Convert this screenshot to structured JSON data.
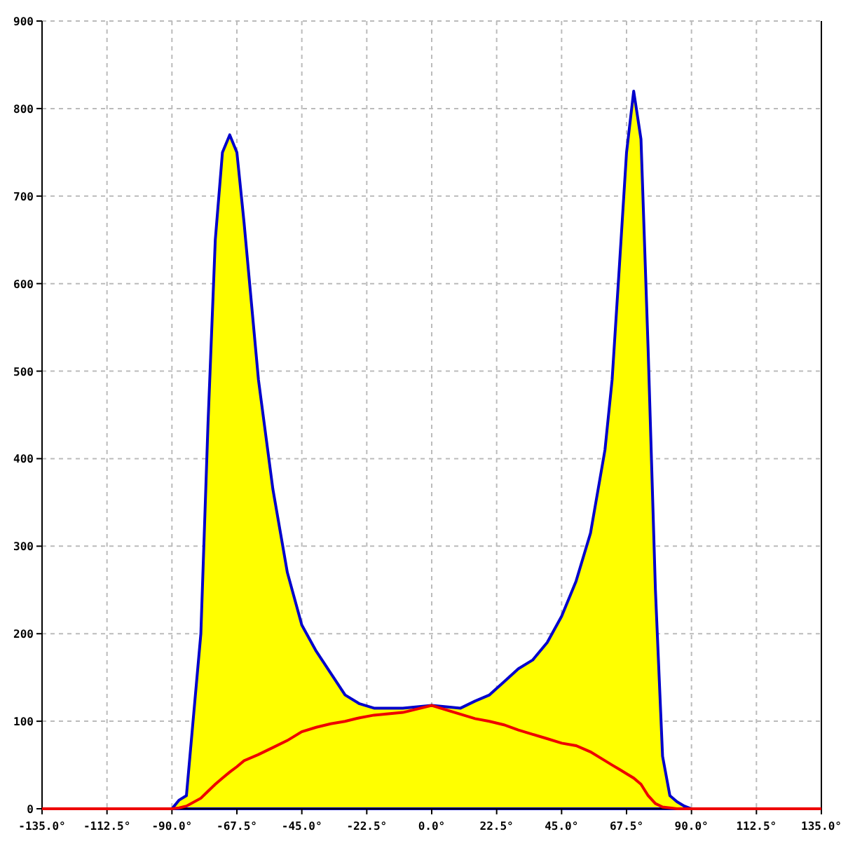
{
  "chart_data": {
    "type": "area",
    "x": [
      -135,
      -112.5,
      -90,
      -87.5,
      -85,
      -80,
      -77.5,
      -75,
      -72.5,
      -70,
      -67.5,
      -65,
      -60,
      -55,
      -50,
      -45,
      -40,
      -35,
      -30,
      -25,
      -20,
      -10,
      0,
      10,
      15,
      20,
      25,
      30,
      35,
      40,
      45,
      50,
      55,
      60,
      62.5,
      65,
      67.5,
      70,
      72.5,
      75,
      77.5,
      80,
      82.5,
      85,
      87.5,
      90,
      112.5,
      135
    ],
    "series": [
      {
        "type": "area",
        "color": "#ffff00",
        "values": [
          null,
          null,
          0,
          10,
          15,
          200,
          440,
          650,
          750,
          770,
          750,
          670,
          490,
          365,
          270,
          210,
          180,
          155,
          130,
          120,
          115,
          115,
          118,
          115,
          123,
          130,
          145,
          160,
          170,
          190,
          220,
          260,
          315,
          410,
          490,
          620,
          750,
          820,
          765,
          525,
          250,
          60,
          15,
          8,
          3,
          0,
          null,
          null
        ]
      },
      {
        "type": "line",
        "color": "#ee0000",
        "values": [
          0,
          0,
          0,
          1,
          3,
          12,
          20,
          28,
          35,
          42,
          48,
          55,
          62,
          70,
          78,
          88,
          93,
          97,
          100,
          104,
          107,
          110,
          118,
          108,
          103,
          100,
          96,
          90,
          85,
          80,
          75,
          72,
          65,
          55,
          50,
          45,
          40,
          35,
          28,
          15,
          6,
          2,
          1,
          0,
          0,
          0,
          0,
          0
        ]
      }
    ],
    "xlim": [
      -135,
      135
    ],
    "ylim": [
      0,
      900
    ],
    "grid": true,
    "xticks": [
      {
        "value": -135,
        "label": "-135.0°"
      },
      {
        "value": -112.5,
        "label": "-112.5°"
      },
      {
        "value": -90,
        "label": "-90.0°"
      },
      {
        "value": -67.5,
        "label": "-67.5°"
      },
      {
        "value": -45,
        "label": "-45.0°"
      },
      {
        "value": -22.5,
        "label": "-22.5°"
      },
      {
        "value": 0,
        "label": "0.0°"
      },
      {
        "value": 22.5,
        "label": "22.5°"
      },
      {
        "value": 45,
        "label": "45.0°"
      },
      {
        "value": 67.5,
        "label": "67.5°"
      },
      {
        "value": 90,
        "label": "90.0°"
      },
      {
        "value": 112.5,
        "label": "112.5°"
      },
      {
        "value": 135,
        "label": "135.0°"
      }
    ],
    "yticks": [
      0,
      100,
      200,
      300,
      400,
      500,
      600,
      700,
      800,
      900
    ]
  }
}
